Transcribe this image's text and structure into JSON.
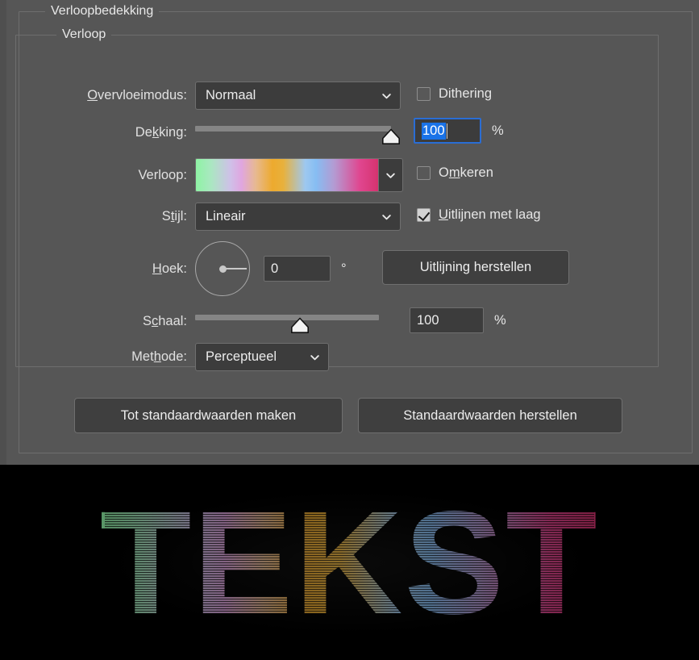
{
  "dialog": {
    "outer_group_label": "Verloopbedekking",
    "inner_group_label": "Verloop",
    "background_color": "#565656",
    "border_color": "#6e6e6e"
  },
  "blend_mode": {
    "label": "Overvloeimodus:",
    "label_accel": "O",
    "value": "Normaal",
    "chevron_icon": "chevron-down-icon"
  },
  "dithering": {
    "label": "Dithering",
    "checked": false,
    "checkbox_icon": "checkbox-unchecked-icon"
  },
  "opacity": {
    "label": "Dekking:",
    "label_accel": "k",
    "value": "100",
    "unit": "%",
    "slider_percent": 100,
    "focused": true,
    "selection_color": "#1a73e8",
    "focus_border_color": "#2a6dd4"
  },
  "gradient": {
    "label": "Verloop:",
    "chevron_icon": "chevron-down-icon",
    "stops": [
      {
        "pos": 0,
        "color": "#8ef3a4"
      },
      {
        "pos": 8,
        "color": "#a9e8c0"
      },
      {
        "pos": 19,
        "color": "#cfc0e8"
      },
      {
        "pos": 25,
        "color": "#e0a6e0"
      },
      {
        "pos": 33,
        "color": "#e7b98f"
      },
      {
        "pos": 42,
        "color": "#edaa2e"
      },
      {
        "pos": 48,
        "color": "#e8b13c"
      },
      {
        "pos": 60,
        "color": "#9ec8f0"
      },
      {
        "pos": 66,
        "color": "#86bdf2"
      },
      {
        "pos": 76,
        "color": "#b49ad2"
      },
      {
        "pos": 90,
        "color": "#e0468f"
      },
      {
        "pos": 100,
        "color": "#d6336f"
      }
    ]
  },
  "reverse": {
    "label": "Omkeren",
    "label_accel": "m",
    "checked": false,
    "checkbox_icon": "checkbox-unchecked-icon"
  },
  "style": {
    "label": "Stijl:",
    "label_accel": "t",
    "value": "Lineair",
    "chevron_icon": "chevron-down-icon"
  },
  "align_with_layer": {
    "label": "Uitlijnen met laag",
    "label_accel": "U",
    "checked": true,
    "checkbox_icon": "checkbox-checked-icon"
  },
  "angle": {
    "label": "Hoek:",
    "label_accel": "H",
    "value": "0",
    "unit": "°",
    "degrees": 0,
    "dial_icon": "angle-dial-icon"
  },
  "reset_alignment": {
    "label": "Uitlijning herstellen"
  },
  "scale": {
    "label": "Schaal:",
    "label_accel": "c",
    "value": "100",
    "unit": "%",
    "slider_percent": 57
  },
  "method": {
    "label": "Methode:",
    "label_accel": "h",
    "value": "Perceptueel",
    "chevron_icon": "chevron-down-icon"
  },
  "footer_buttons": {
    "make_default": "Tot standaardwaarden maken",
    "reset_default": "Standaardwaarden herstellen"
  },
  "canvas": {
    "artwork_text": "TEKST",
    "background_color": "#000000"
  }
}
